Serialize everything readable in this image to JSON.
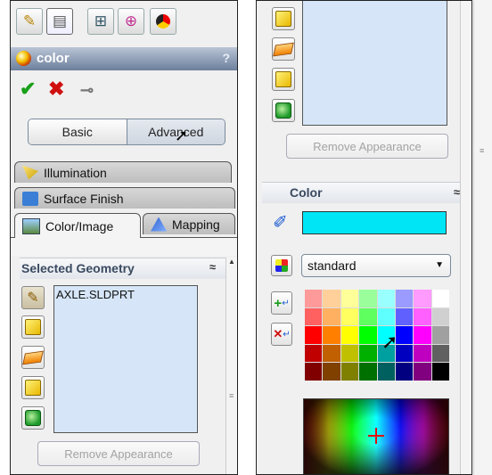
{
  "left_panel": {
    "toolbar": [
      "feature-manager-icon",
      "property-manager-icon",
      "configuration-manager-icon",
      "dimxpert-manager-icon",
      "display-manager-icon"
    ],
    "title": "color",
    "help": "?",
    "ok_icon": "check-icon",
    "cancel_icon": "x-icon",
    "pin_icon": "pushpin-icon",
    "mode_tabs": {
      "basic": "Basic",
      "advanced": "Advanced"
    },
    "tabs": {
      "illumination": "Illumination",
      "surface_finish": "Surface Finish",
      "color_image": "Color/Image",
      "mapping": "Mapping"
    },
    "selected_geometry": {
      "header": "Selected Geometry",
      "items": [
        "AXLE.SLDPRT"
      ],
      "remove_button": "Remove Appearance"
    }
  },
  "right_panel": {
    "remove_button": "Remove Appearance",
    "color_header": "Color",
    "current_color": "#00e5f6",
    "palette_select": "standard"
  }
}
